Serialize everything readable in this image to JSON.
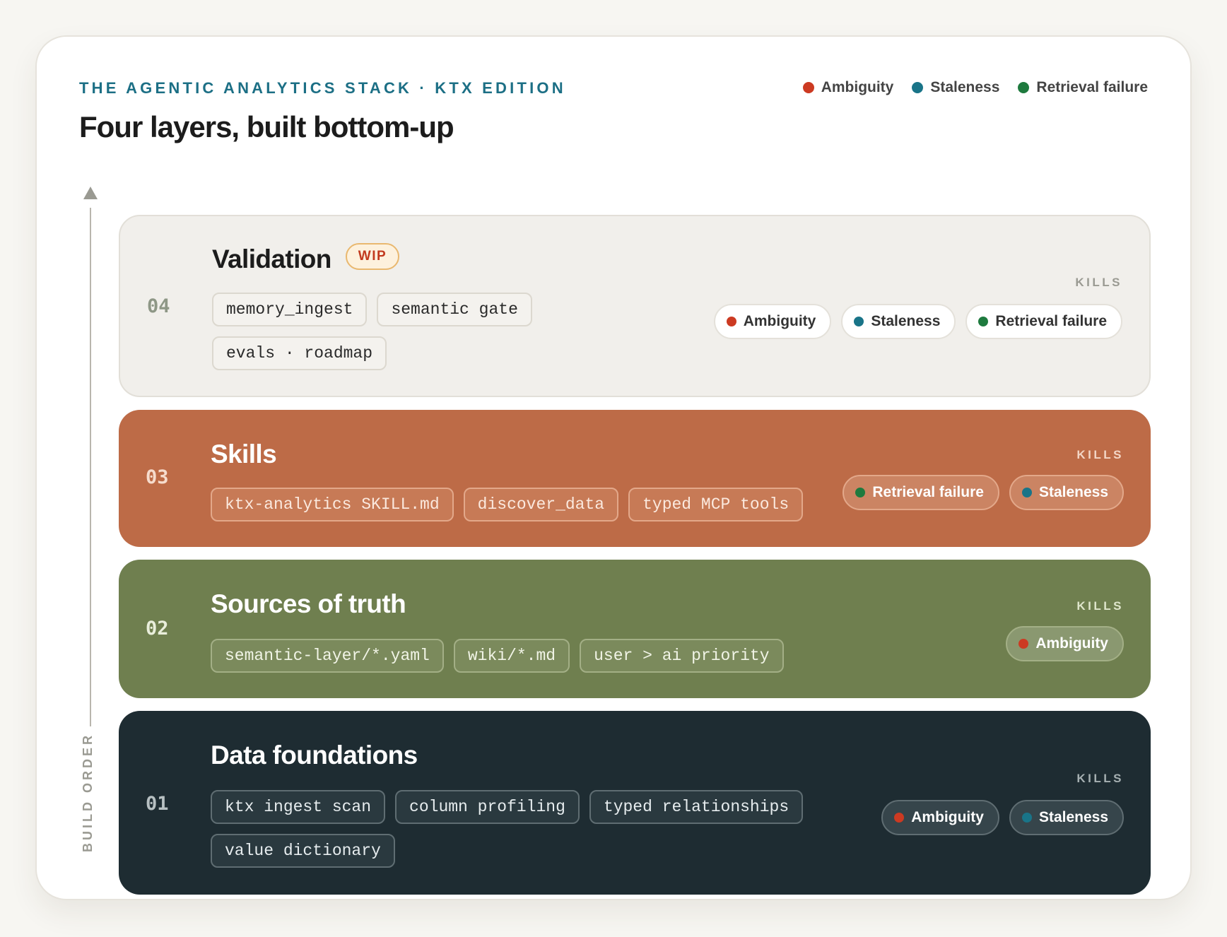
{
  "header": {
    "kicker": "THE AGENTIC ANALYTICS STACK · KTX EDITION",
    "title": "Four layers, built bottom-up"
  },
  "legend": [
    {
      "label": "Ambiguity",
      "color": "#cc3a22"
    },
    {
      "label": "Staleness",
      "color": "#197488"
    },
    {
      "label": "Retrieval failure",
      "color": "#1e7a3e"
    }
  ],
  "axis": {
    "label": "BUILD ORDER"
  },
  "kills_label": "KILLS",
  "layers": [
    {
      "num": "04",
      "name": "Validation",
      "badge": "WIP",
      "tags": [
        "memory_ingest",
        "semantic gate",
        "evals · roadmap"
      ],
      "kills": [
        "Ambiguity",
        "Staleness",
        "Retrieval failure"
      ]
    },
    {
      "num": "03",
      "name": "Skills",
      "tags": [
        "ktx-analytics SKILL.md",
        "discover_data",
        "typed MCP tools"
      ],
      "kills": [
        "Retrieval failure",
        "Staleness"
      ]
    },
    {
      "num": "02",
      "name": "Sources of truth",
      "tags": [
        "semantic-layer/*.yaml",
        "wiki/*.md",
        "user > ai priority"
      ],
      "kills": [
        "Ambiguity"
      ]
    },
    {
      "num": "01",
      "name": "Data foundations",
      "tags": [
        "ktx ingest scan",
        "column profiling",
        "typed relationships",
        "value dictionary"
      ],
      "kills": [
        "Ambiguity",
        "Staleness"
      ]
    }
  ]
}
